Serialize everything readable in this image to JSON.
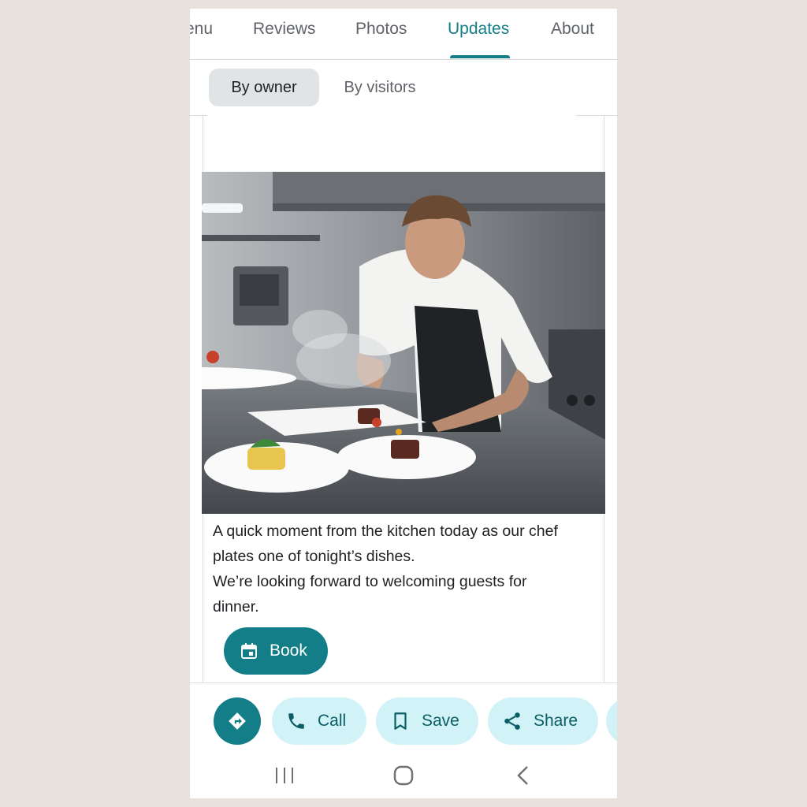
{
  "tabs": [
    {
      "label": "Menu",
      "active": false
    },
    {
      "label": "Reviews",
      "active": false
    },
    {
      "label": "Photos",
      "active": false
    },
    {
      "label": "Updates",
      "active": true
    },
    {
      "label": "About",
      "active": false
    }
  ],
  "tab_partial_visible_text": "enu",
  "filters": {
    "by_owner": "By owner",
    "by_visitors": "By visitors",
    "selected": "By owner"
  },
  "post": {
    "image_description_icon": "chef-plating-photo",
    "text_lines": [
      "A quick moment from the kitchen today as our chef",
      "plates one of tonight’s dishes.",
      "We’re looking forward to welcoming guests for",
      "dinner."
    ],
    "book_label": "Book"
  },
  "actions": {
    "call": "Call",
    "save": "Save",
    "share": "Share"
  },
  "colors": {
    "accent": "#137e87",
    "pill_bg": "#d1f2f6",
    "chip_selected_bg": "#e1e4e6",
    "page_bg": "#e9e2dc"
  }
}
